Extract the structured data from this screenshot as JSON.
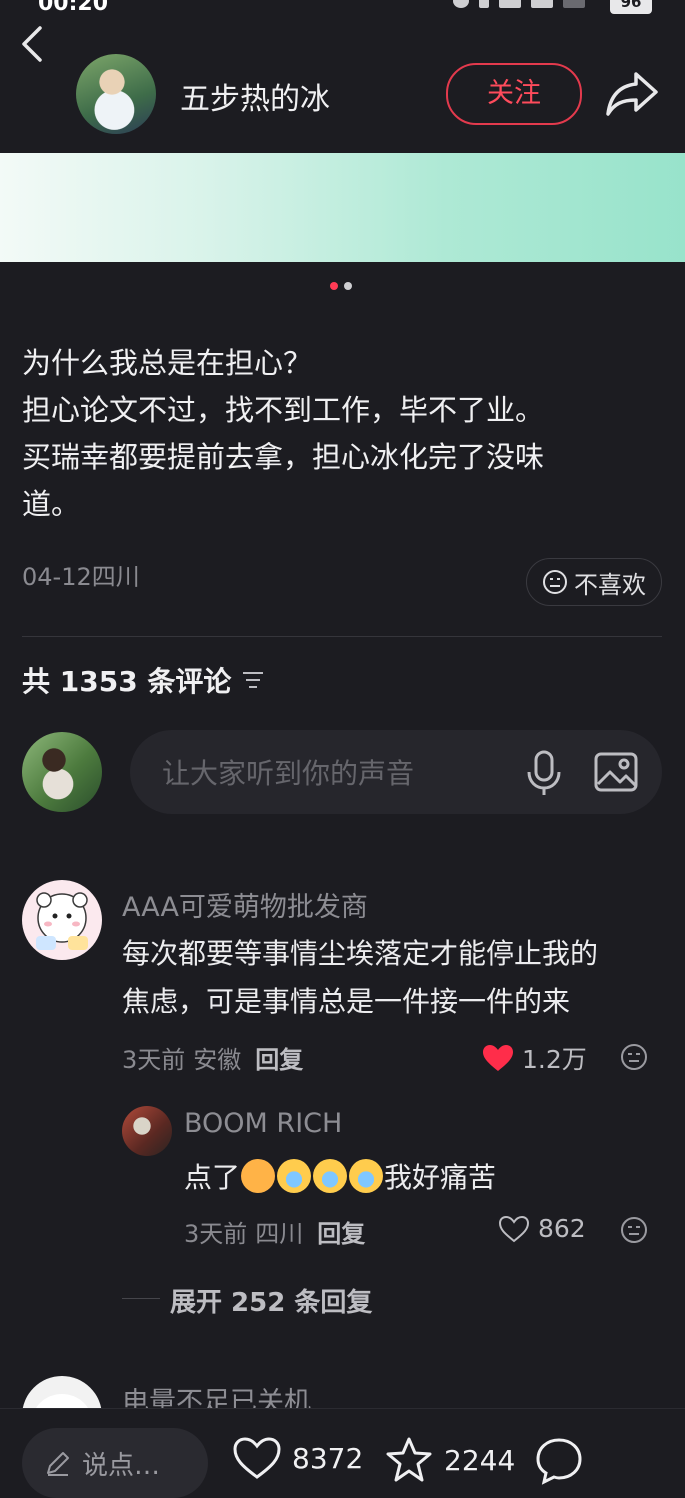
{
  "status": {
    "time": "00:20",
    "battery": "96"
  },
  "header": {
    "username": "五步热的冰",
    "follow_label": "关注"
  },
  "carousel": {
    "dots": 2,
    "active": 0
  },
  "post": {
    "lines": [
      "为什么我总是在担心？",
      "担心论文不过，找不到工作，毕不了业。",
      "买瑞幸都要提前去拿，担心冰化完了没味",
      "道。"
    ],
    "date_location": "04-12四川",
    "dislike_label": "不喜欢"
  },
  "comments_header": {
    "count_label": "共 1353 条评论"
  },
  "comment_input": {
    "placeholder": "让大家听到你的声音"
  },
  "comments": [
    {
      "name": "AAA可爱萌物批发商",
      "text_lines": [
        "每次都要等事情尘埃落定才能停止我的",
        "焦虑，可是事情总是一件接一件的来"
      ],
      "time": "3天前",
      "location": "安徽",
      "reply_label": "回复",
      "likes": "1.2万"
    }
  ],
  "reply": {
    "name": "BOOM RICH",
    "prefix": "点了",
    "suffix": "我好痛苦",
    "time": "3天前",
    "location": "四川",
    "reply_label": "回复",
    "likes": "862"
  },
  "expand_label": "展开 252 条回复",
  "comment2": {
    "name": "电量不足已关机"
  },
  "bottom": {
    "say_label": "说点…",
    "likes": "8372",
    "favorites": "2244"
  },
  "colors": {
    "accent": "#ff3b55",
    "background": "#1c1c21"
  }
}
